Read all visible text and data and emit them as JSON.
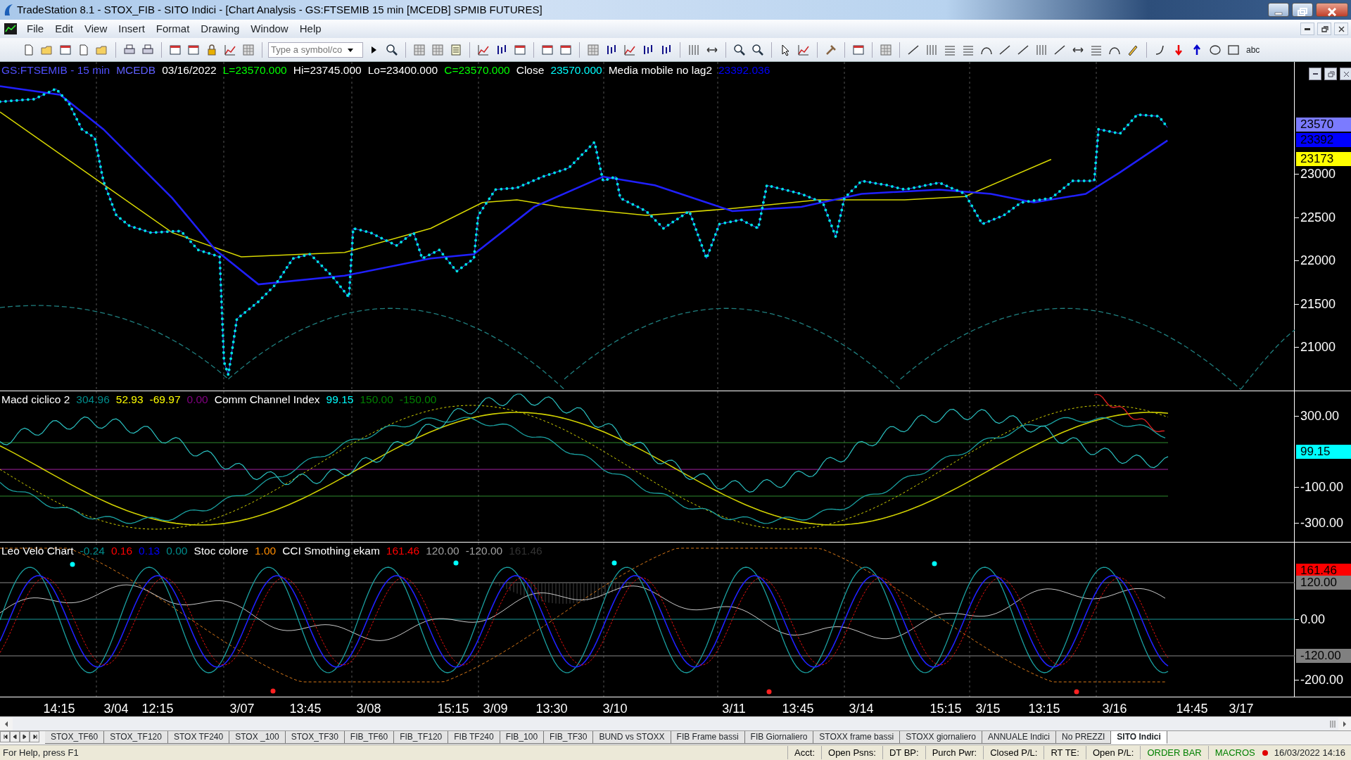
{
  "window": {
    "title": "TradeStation 8.1 - STOX_FIB - SITO Indici - [Chart Analysis - GS:FTSEMIB  15 min  [MCEDB] SPMIB FUTURES]"
  },
  "menu": [
    "File",
    "Edit",
    "View",
    "Insert",
    "Format",
    "Drawing",
    "Window",
    "Help"
  ],
  "toolbar": {
    "symbol_field": {
      "placeholder": "Type a symbol/co"
    },
    "text_tool": "abc"
  },
  "price_panel": {
    "legend": [
      {
        "text": "GS:FTSEMIB - 15 min",
        "color": "#5050ff"
      },
      {
        "text": "MCEDB",
        "color": "#6060ff"
      },
      {
        "text": "03/16/2022",
        "color": "#ffffff"
      },
      {
        "text": "L=23570.000",
        "color": "#00ff00"
      },
      {
        "text": "Hi=23745.000",
        "color": "#ffffff"
      },
      {
        "text": "Lo=23400.000",
        "color": "#ffffff"
      },
      {
        "text": "C=23570.000",
        "color": "#00ff00"
      },
      {
        "text": "Close",
        "color": "#ffffff"
      },
      {
        "text": "23570.000",
        "color": "#00ffff"
      },
      {
        "text": "Media mobile no lag2",
        "color": "#ffffff"
      },
      {
        "text": "23392.036",
        "color": "#0000ff"
      }
    ],
    "axis_labels": [
      "23000",
      "22500",
      "22000",
      "21500",
      "21000"
    ],
    "markers": [
      {
        "text": "23570",
        "color": "#7b7bff"
      },
      {
        "text": "23392",
        "color": "#0000ff"
      },
      {
        "text": "23173",
        "color": "#ffff00"
      }
    ]
  },
  "indicator_panel": {
    "legend": [
      {
        "text": "Macd ciclico 2",
        "color": "#ffffff"
      },
      {
        "text": "304.96",
        "color": "#008b8b"
      },
      {
        "text": "52.93",
        "color": "#ffff00"
      },
      {
        "text": "-69.97",
        "color": "#ffff00"
      },
      {
        "text": "0.00",
        "color": "#800080"
      },
      {
        "text": "Comm Channel Index",
        "color": "#ffffff"
      },
      {
        "text": "99.15",
        "color": "#00ffff"
      },
      {
        "text": "150.00",
        "color": "#008000"
      },
      {
        "text": "-150.00",
        "color": "#008000"
      }
    ],
    "axis_labels": [
      "300.00",
      "-100.00",
      "-300.00"
    ],
    "markers": [
      {
        "text": "99.15",
        "color": "#00ffff"
      }
    ]
  },
  "oscillator_panel": {
    "legend": [
      {
        "text": "Leo Velo Chart",
        "color": "#ffffff"
      },
      {
        "text": "-0.24",
        "color": "#008b8b"
      },
      {
        "text": "0.16",
        "color": "#ff0000"
      },
      {
        "text": "0.13",
        "color": "#0000ff"
      },
      {
        "text": "0.00",
        "color": "#008b8b"
      },
      {
        "text": "Stoc colore",
        "color": "#ffffff"
      },
      {
        "text": "1.00",
        "color": "#ff8c00"
      },
      {
        "text": "CCI Smothing ekam",
        "color": "#ffffff"
      },
      {
        "text": "161.46",
        "color": "#ff0000"
      },
      {
        "text": "120.00",
        "color": "#a0a0a0"
      },
      {
        "text": "-120.00",
        "color": "#a0a0a0"
      },
      {
        "text": "161.46",
        "color": "#333333"
      }
    ],
    "axis_labels": [
      "0.00",
      "-200.00"
    ],
    "markers": [
      {
        "text": "161.46",
        "color": "#ff0000"
      },
      {
        "text": "120.00",
        "color": "#808080"
      },
      {
        "text": "-120.00",
        "color": "#808080"
      }
    ]
  },
  "time_axis": [
    "14:15",
    "3/04",
    "12:15",
    "3/07",
    "13:45",
    "3/08",
    "15:15",
    "3/09",
    "13:30",
    "3/10",
    "3/11",
    "13:45",
    "3/14",
    "15:15",
    "3/15",
    "13:15",
    "3/16",
    "14:45",
    "3/17"
  ],
  "sheet_tabs": [
    {
      "label": "STOX_TF60",
      "selected": false
    },
    {
      "label": "STOX_TF120",
      "selected": false
    },
    {
      "label": "STOX TF240",
      "selected": false
    },
    {
      "label": "STOX _100",
      "selected": false
    },
    {
      "label": "STOX_TF30",
      "selected": false
    },
    {
      "label": "FIB_TF60",
      "selected": false
    },
    {
      "label": "FIB_TF120",
      "selected": false
    },
    {
      "label": "FIB TF240",
      "selected": false
    },
    {
      "label": "FIB_100",
      "selected": false
    },
    {
      "label": "FIB_TF30",
      "selected": false
    },
    {
      "label": "BUND vs STOXX",
      "selected": false
    },
    {
      "label": "FIB Frame bassi",
      "selected": false
    },
    {
      "label": "FIB Giornaliero",
      "selected": false
    },
    {
      "label": "STOXX frame bassi",
      "selected": false
    },
    {
      "label": "STOXX giornaliero",
      "selected": false
    },
    {
      "label": "ANNUALE Indici",
      "selected": false
    },
    {
      "label": "No PREZZI",
      "selected": false
    },
    {
      "label": "SITO Indici",
      "selected": true
    }
  ],
  "status_bar": {
    "help": "For Help, press F1",
    "fields": [
      {
        "text": "Acct:",
        "color": "#000000"
      },
      {
        "text": "Open Psns:",
        "color": "#000000"
      },
      {
        "text": "DT BP:",
        "color": "#000000"
      },
      {
        "text": "Purch Pwr:",
        "color": "#000000"
      },
      {
        "text": "Closed P/L:",
        "color": "#000000"
      },
      {
        "text": "RT TE:",
        "color": "#000000"
      },
      {
        "text": "Open P/L:",
        "color": "#000000"
      },
      {
        "text": "ORDER BAR",
        "color": "#008000"
      },
      {
        "text": "MACROS",
        "color": "#008000"
      }
    ],
    "clock": "16/03/2022 14:16"
  }
}
